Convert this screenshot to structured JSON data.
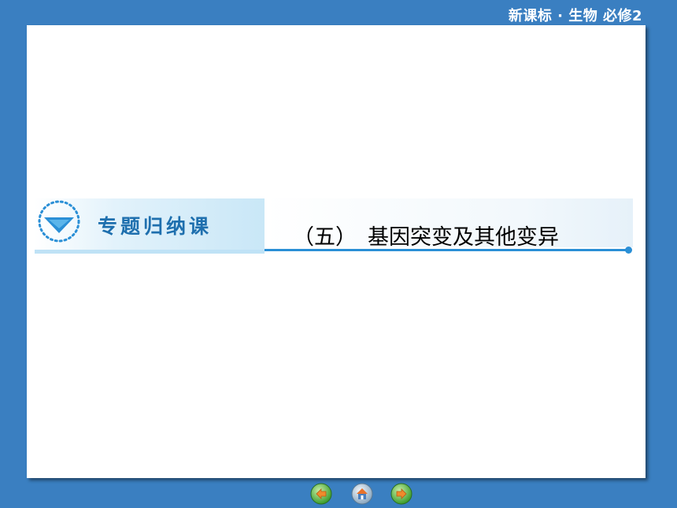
{
  "header": {
    "course_label": "新课标 · 生物    必修2"
  },
  "banner": {
    "section_label": "专题归纳课",
    "topic_number": "（五）",
    "topic_title": "基因突变及其他变异"
  },
  "nav": {
    "buttons": [
      {
        "icon": "previous-icon"
      },
      {
        "icon": "home-icon"
      },
      {
        "icon": "next-icon"
      }
    ]
  },
  "colors": {
    "background": "#3a7fc1",
    "slide": "#ffffff",
    "accent": "#2a8fd6",
    "badge_text": "#1e6fae"
  }
}
